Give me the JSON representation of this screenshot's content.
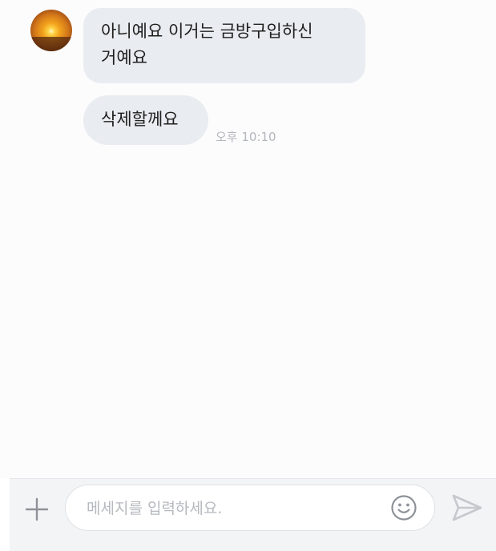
{
  "messages": [
    {
      "text_line1": "아니예요 이거는 금방구입하신",
      "text_line2": "거예요"
    },
    {
      "text": "삭제할께요",
      "time": "오후 10:10"
    }
  ],
  "avatar": {
    "icon": "sunset-photo-avatar"
  },
  "composer": {
    "placeholder": "메세지를 입력하세요.",
    "plus_icon": "plus-icon",
    "emoji_icon": "smiley-icon",
    "send_icon": "send-arrow-icon"
  },
  "colors": {
    "bubble": "#e9ecf0",
    "timestamp": "#b3b6bb",
    "placeholder": "#b6b9be",
    "icon": "#8e9298",
    "send_icon": "#c5c8cd"
  }
}
